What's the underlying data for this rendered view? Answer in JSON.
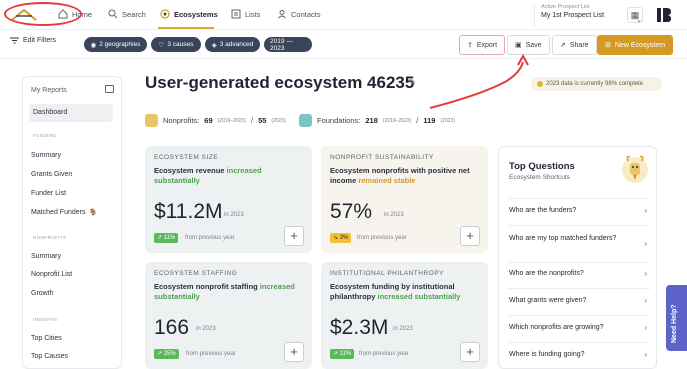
{
  "nav": {
    "items": [
      {
        "label": "Home",
        "icon": "home-icon"
      },
      {
        "label": "Search",
        "icon": "search-icon"
      },
      {
        "label": "Ecosystems",
        "icon": "ecosystems-icon"
      },
      {
        "label": "Lists",
        "icon": "lists-icon"
      },
      {
        "label": "Contacts",
        "icon": "contacts-icon"
      }
    ],
    "active": "Ecosystems",
    "prospect_label": "Active Prospect List",
    "prospect_value": "My 1st Prospect List"
  },
  "filters": {
    "edit_label": "Edit Filters",
    "chips": [
      "2 geographies",
      "3 causes",
      "3 advanced",
      "2019 — 2023"
    ]
  },
  "actions": {
    "export": "Export",
    "save": "Save",
    "share": "Share",
    "new_ecosystem": "New Ecosystem"
  },
  "sidebar": {
    "header": "My Reports",
    "dashboard": "Dashboard",
    "sections": [
      {
        "title": "FUNDING",
        "items": [
          "Summary",
          "Grants Given",
          "Funder List",
          "Matched Funders"
        ]
      },
      {
        "title": "NONPROFITS",
        "items": [
          "Summary",
          "Nonprofit List",
          "Growth"
        ]
      },
      {
        "title": "INSIGHTS",
        "items": [
          "Top Cities",
          "Top Causes"
        ]
      }
    ]
  },
  "main": {
    "title": "User-generated ecosystem 46235",
    "complete_note": "2023 data is currently 98% complete",
    "nonprofits_label": "Nonprofits:",
    "nonprofits_v1": "69",
    "nonprofits_y1": "(2019–2023)",
    "nonprofits_v2": "55",
    "nonprofits_y2": "(2023)",
    "foundations_label": "Foundations:",
    "foundations_v1": "218",
    "foundations_y1": "(2019–2023)",
    "foundations_v2": "119",
    "foundations_y2": "(2023)"
  },
  "cards": [
    {
      "cap": "ECOSYSTEM SIZE",
      "desc_a": "Ecosystem revenue ",
      "desc_hl": "increased substantially",
      "desc_b": "",
      "value": "$11.2M",
      "year": "in 2023",
      "pill": "↗ 11%",
      "fpy": "from previous year"
    },
    {
      "cap": "NONPROFIT SUSTAINABILITY",
      "desc_a": "Ecosystem nonprofits with positive net income ",
      "desc_hl": "remained stable",
      "desc_b": "",
      "value": "57%",
      "year": "in 2023",
      "pill": "↘ 3%",
      "fpy": "from previous year"
    },
    {
      "cap": "ECOSYSTEM STAFFING",
      "desc_a": "Ecosystem nonprofit staffing ",
      "desc_hl": "increased substantially",
      "desc_b": "",
      "value": "166",
      "year": "in 2023",
      "pill": "↗ 25%",
      "fpy": "from previous year"
    },
    {
      "cap": "INSTITUTIONAL PHILANTHROPY",
      "desc_a": "Ecosystem funding by institutional philanthropy ",
      "desc_hl": "increased substantially",
      "desc_b": "",
      "value": "$2.3M",
      "year": "in 2023",
      "pill": "↗ 11%",
      "fpy": "from previous year"
    }
  ],
  "top_questions": {
    "title": "Top Questions",
    "subtitle": "Ecosystem Shortcuts",
    "items": [
      "Who are the funders?",
      "Who are my top matched funders?",
      "Who are the nonprofits?",
      "What grants were given?",
      "Which nonprofits are growing?",
      "Where is funding going?"
    ]
  },
  "help": {
    "label": "Need Help?"
  },
  "colors": {
    "accent": "#d49a23",
    "chip": "#39455a",
    "positive": "#4aa24a",
    "annotation": "#e23b3b",
    "help": "#5e63c9"
  }
}
